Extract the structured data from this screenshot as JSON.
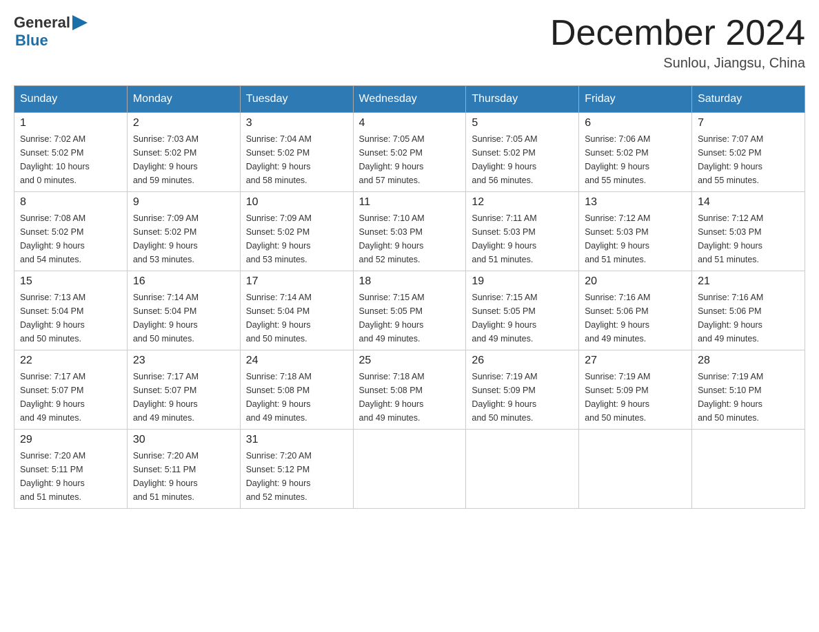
{
  "header": {
    "logo_general": "General",
    "logo_blue": "Blue",
    "month_title": "December 2024",
    "location": "Sunlou, Jiangsu, China"
  },
  "days_of_week": [
    "Sunday",
    "Monday",
    "Tuesday",
    "Wednesday",
    "Thursday",
    "Friday",
    "Saturday"
  ],
  "weeks": [
    [
      {
        "day": "1",
        "sunrise": "7:02 AM",
        "sunset": "5:02 PM",
        "daylight_hours": "10",
        "daylight_minutes": "0"
      },
      {
        "day": "2",
        "sunrise": "7:03 AM",
        "sunset": "5:02 PM",
        "daylight_hours": "9",
        "daylight_minutes": "59"
      },
      {
        "day": "3",
        "sunrise": "7:04 AM",
        "sunset": "5:02 PM",
        "daylight_hours": "9",
        "daylight_minutes": "58"
      },
      {
        "day": "4",
        "sunrise": "7:05 AM",
        "sunset": "5:02 PM",
        "daylight_hours": "9",
        "daylight_minutes": "57"
      },
      {
        "day": "5",
        "sunrise": "7:05 AM",
        "sunset": "5:02 PM",
        "daylight_hours": "9",
        "daylight_minutes": "56"
      },
      {
        "day": "6",
        "sunrise": "7:06 AM",
        "sunset": "5:02 PM",
        "daylight_hours": "9",
        "daylight_minutes": "55"
      },
      {
        "day": "7",
        "sunrise": "7:07 AM",
        "sunset": "5:02 PM",
        "daylight_hours": "9",
        "daylight_minutes": "55"
      }
    ],
    [
      {
        "day": "8",
        "sunrise": "7:08 AM",
        "sunset": "5:02 PM",
        "daylight_hours": "9",
        "daylight_minutes": "54"
      },
      {
        "day": "9",
        "sunrise": "7:09 AM",
        "sunset": "5:02 PM",
        "daylight_hours": "9",
        "daylight_minutes": "53"
      },
      {
        "day": "10",
        "sunrise": "7:09 AM",
        "sunset": "5:02 PM",
        "daylight_hours": "9",
        "daylight_minutes": "53"
      },
      {
        "day": "11",
        "sunrise": "7:10 AM",
        "sunset": "5:03 PM",
        "daylight_hours": "9",
        "daylight_minutes": "52"
      },
      {
        "day": "12",
        "sunrise": "7:11 AM",
        "sunset": "5:03 PM",
        "daylight_hours": "9",
        "daylight_minutes": "51"
      },
      {
        "day": "13",
        "sunrise": "7:12 AM",
        "sunset": "5:03 PM",
        "daylight_hours": "9",
        "daylight_minutes": "51"
      },
      {
        "day": "14",
        "sunrise": "7:12 AM",
        "sunset": "5:03 PM",
        "daylight_hours": "9",
        "daylight_minutes": "51"
      }
    ],
    [
      {
        "day": "15",
        "sunrise": "7:13 AM",
        "sunset": "5:04 PM",
        "daylight_hours": "9",
        "daylight_minutes": "50"
      },
      {
        "day": "16",
        "sunrise": "7:14 AM",
        "sunset": "5:04 PM",
        "daylight_hours": "9",
        "daylight_minutes": "50"
      },
      {
        "day": "17",
        "sunrise": "7:14 AM",
        "sunset": "5:04 PM",
        "daylight_hours": "9",
        "daylight_minutes": "50"
      },
      {
        "day": "18",
        "sunrise": "7:15 AM",
        "sunset": "5:05 PM",
        "daylight_hours": "9",
        "daylight_minutes": "49"
      },
      {
        "day": "19",
        "sunrise": "7:15 AM",
        "sunset": "5:05 PM",
        "daylight_hours": "9",
        "daylight_minutes": "49"
      },
      {
        "day": "20",
        "sunrise": "7:16 AM",
        "sunset": "5:06 PM",
        "daylight_hours": "9",
        "daylight_minutes": "49"
      },
      {
        "day": "21",
        "sunrise": "7:16 AM",
        "sunset": "5:06 PM",
        "daylight_hours": "9",
        "daylight_minutes": "49"
      }
    ],
    [
      {
        "day": "22",
        "sunrise": "7:17 AM",
        "sunset": "5:07 PM",
        "daylight_hours": "9",
        "daylight_minutes": "49"
      },
      {
        "day": "23",
        "sunrise": "7:17 AM",
        "sunset": "5:07 PM",
        "daylight_hours": "9",
        "daylight_minutes": "49"
      },
      {
        "day": "24",
        "sunrise": "7:18 AM",
        "sunset": "5:08 PM",
        "daylight_hours": "9",
        "daylight_minutes": "49"
      },
      {
        "day": "25",
        "sunrise": "7:18 AM",
        "sunset": "5:08 PM",
        "daylight_hours": "9",
        "daylight_minutes": "49"
      },
      {
        "day": "26",
        "sunrise": "7:19 AM",
        "sunset": "5:09 PM",
        "daylight_hours": "9",
        "daylight_minutes": "50"
      },
      {
        "day": "27",
        "sunrise": "7:19 AM",
        "sunset": "5:09 PM",
        "daylight_hours": "9",
        "daylight_minutes": "50"
      },
      {
        "day": "28",
        "sunrise": "7:19 AM",
        "sunset": "5:10 PM",
        "daylight_hours": "9",
        "daylight_minutes": "50"
      }
    ],
    [
      {
        "day": "29",
        "sunrise": "7:20 AM",
        "sunset": "5:11 PM",
        "daylight_hours": "9",
        "daylight_minutes": "51"
      },
      {
        "day": "30",
        "sunrise": "7:20 AM",
        "sunset": "5:11 PM",
        "daylight_hours": "9",
        "daylight_minutes": "51"
      },
      {
        "day": "31",
        "sunrise": "7:20 AM",
        "sunset": "5:12 PM",
        "daylight_hours": "9",
        "daylight_minutes": "52"
      },
      null,
      null,
      null,
      null
    ]
  ]
}
